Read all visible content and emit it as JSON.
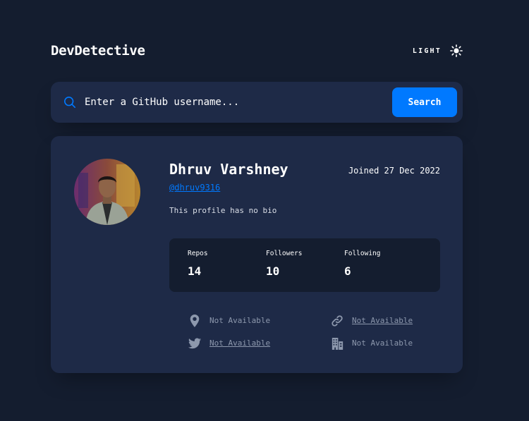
{
  "header": {
    "logo": "DevDetective",
    "theme_label": "LIGHT",
    "theme_icon": "sun-icon"
  },
  "search": {
    "icon": "search-icon",
    "placeholder": "Enter a GitHub username...",
    "value": "",
    "button_label": "Search"
  },
  "profile": {
    "name": "Dhruv Varshney",
    "login": "@dhruv9316",
    "joined": "Joined 27 Dec 2022",
    "bio": "This profile has no bio",
    "stats": [
      {
        "label": "Repos",
        "value": "14"
      },
      {
        "label": "Followers",
        "value": "10"
      },
      {
        "label": "Following",
        "value": "6"
      }
    ],
    "links": {
      "location": {
        "icon": "location-pin-icon",
        "text": "Not Available"
      },
      "website": {
        "icon": "link-icon",
        "text": "Not Available"
      },
      "twitter": {
        "icon": "twitter-icon",
        "text": "Not Available"
      },
      "company": {
        "icon": "building-icon",
        "text": "Not Available"
      }
    }
  },
  "colors": {
    "background": "#141d2f",
    "card": "#1e2a47",
    "accent": "#0079ff",
    "muted": "#8d98ad"
  }
}
